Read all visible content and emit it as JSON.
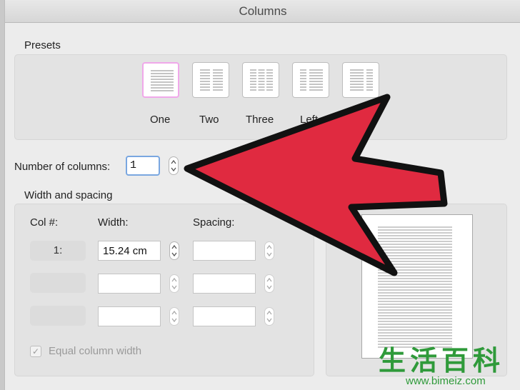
{
  "dialog": {
    "title": "Columns"
  },
  "presets": {
    "heading": "Presets",
    "items": [
      {
        "label": "One",
        "selected": true
      },
      {
        "label": "Two",
        "selected": false
      },
      {
        "label": "Three",
        "selected": false
      },
      {
        "label": "Left",
        "selected": false
      },
      {
        "label": "",
        "selected": false
      }
    ]
  },
  "number_of_columns": {
    "label": "Number of columns:",
    "value": "1"
  },
  "width_spacing": {
    "heading": "Width and spacing",
    "headers": {
      "col": "Col #:",
      "width": "Width:",
      "spacing": "Spacing:"
    },
    "rows": [
      {
        "col": "1:",
        "width": "15.24 cm",
        "spacing": ""
      },
      {
        "col": "",
        "width": "",
        "spacing": ""
      },
      {
        "col": "",
        "width": "",
        "spacing": ""
      }
    ],
    "equal_width": {
      "label": "Equal column width",
      "checked": true
    }
  },
  "colors": {
    "arrow": "#e02a40",
    "watermark": "#2f9a3a"
  },
  "watermark": {
    "chars": "生活百科",
    "url": "www.bimeiz.com"
  }
}
